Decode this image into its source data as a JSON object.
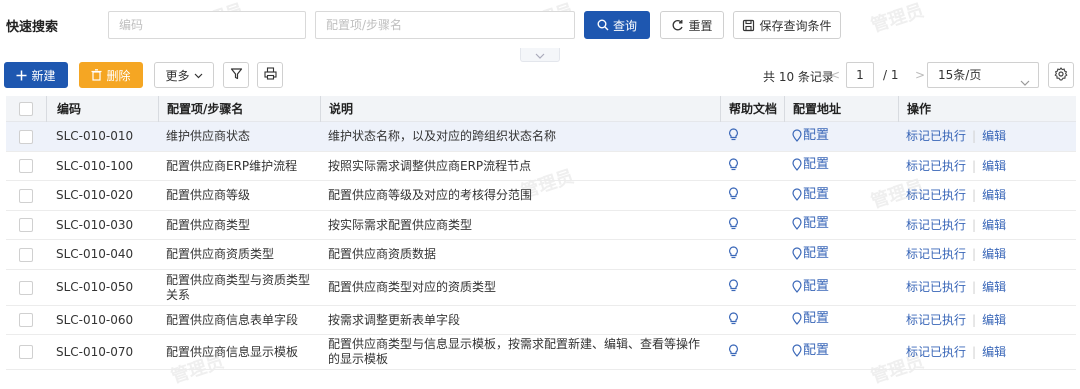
{
  "search": {
    "title": "快速搜索",
    "code_placeholder": "编码",
    "name_placeholder": "配置项/步骤名",
    "query_label": "查询",
    "reset_label": "重置",
    "save_label": "保存查询条件"
  },
  "toolbar": {
    "new_label": "新建",
    "delete_label": "删除",
    "more_label": "更多"
  },
  "pager": {
    "total": "共 10 条记录",
    "prev": "<",
    "page": "1",
    "of": "/  1",
    "next": ">",
    "page_size": "15条/页"
  },
  "table": {
    "headers": {
      "code": "编码",
      "name": "配置项/步骤名",
      "desc": "说明",
      "help": "帮助文档",
      "url": "配置地址",
      "ops": "操作"
    },
    "rows": [
      {
        "code": "SLC-010-010",
        "name": "维护供应商状态",
        "desc": "维护状态名称，以及对应的跨组织状态名称",
        "url": "配置",
        "op1": "标记已执行",
        "op2": "编辑"
      },
      {
        "code": "SLC-010-100",
        "name": "配置供应商ERP维护流程",
        "desc": "按照实际需求调整供应商ERP流程节点",
        "url": "配置",
        "op1": "标记已执行",
        "op2": "编辑"
      },
      {
        "code": "SLC-010-020",
        "name": "配置供应商等级",
        "desc": "配置供应商等级及对应的考核得分范围",
        "url": "配置",
        "op1": "标记已执行",
        "op2": "编辑"
      },
      {
        "code": "SLC-010-030",
        "name": "配置供应商类型",
        "desc": "按实际需求配置供应商类型",
        "url": "配置",
        "op1": "标记已执行",
        "op2": "编辑"
      },
      {
        "code": "SLC-010-040",
        "name": "配置供应商资质类型",
        "desc": "配置供应商资质数据",
        "url": "配置",
        "op1": "标记已执行",
        "op2": "编辑"
      },
      {
        "code": "SLC-010-050",
        "name": "配置供应商类型与资质类型关系",
        "desc": "配置供应商类型对应的资质类型",
        "url": "配置",
        "op1": "标记已执行",
        "op2": "编辑"
      },
      {
        "code": "SLC-010-060",
        "name": "配置供应商信息表单字段",
        "desc": "按需求调整更新表单字段",
        "url": "配置",
        "op1": "标记已执行",
        "op2": "编辑"
      },
      {
        "code": "SLC-010-070",
        "name": "配置供应商信息显示模板",
        "desc": "配置供应商类型与信息显示模板，按需求配置新建、编辑、查看等操作的显示模板",
        "url": "配置",
        "op1": "标记已执行",
        "op2": "编辑"
      }
    ]
  },
  "watermark": "管理员",
  "colors": {
    "primary": "#1e57b0",
    "warning": "#f5a623",
    "link": "#3a67b8",
    "row_highlight": "#eef2fa"
  },
  "icons": [
    "search-icon",
    "refresh-icon",
    "save-icon",
    "plus-icon",
    "trash-icon",
    "chevron-down-icon",
    "filter-icon",
    "print-icon",
    "gear-icon",
    "lightbulb-icon",
    "location-pin-icon"
  ]
}
